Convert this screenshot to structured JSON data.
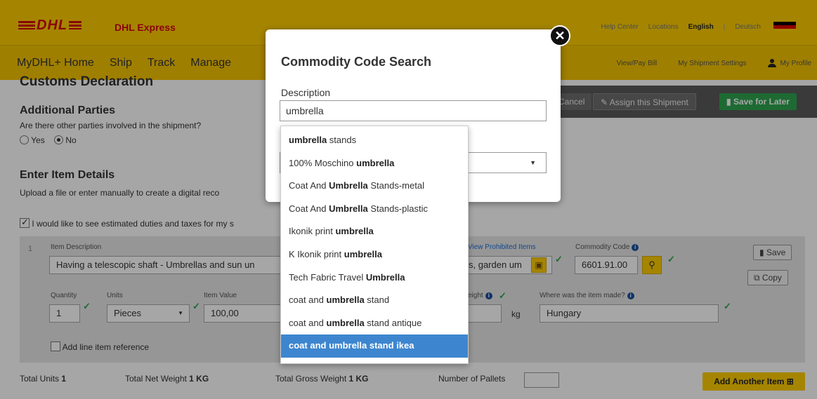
{
  "header": {
    "logo_text": "DHL",
    "brand": "DHL Express",
    "links": [
      "Help Center",
      "Locations"
    ],
    "lang_active": "English",
    "lang_other": "Deutsch"
  },
  "nav": {
    "left": [
      "MyDHL+ Home",
      "Ship",
      "Track",
      "Manage"
    ],
    "right": [
      "View/Pay Bill",
      "My Shipment Settings"
    ],
    "profile": "My Profile"
  },
  "page": {
    "section_title": "Customs Declaration",
    "actions": {
      "cancel": "Cancel",
      "assign": "Assign this Shipment",
      "save_later": "Save for Later"
    },
    "additional_parties": {
      "title": "Additional Parties",
      "question": "Are there other parties involved in the shipment?",
      "yes": "Yes",
      "no": "No"
    },
    "item_details": {
      "title": "Enter Item Details",
      "subtitle": "Upload a file or enter manually to create a digital reco",
      "estimate_checkbox": "I would like to see estimated duties and taxes for my s"
    },
    "item": {
      "number": "1",
      "description_label": "Item Description",
      "description_value": "Having a telescopic shaft - Umbrellas and sun un",
      "prohibited_link": "View Prohibited Items",
      "description_tail": "s, garden um",
      "commodity_label": "Commodity Code",
      "commodity_value": "6601.91.00",
      "save": "Save",
      "copy": "Copy",
      "quantity_label": "Quantity",
      "quantity_value": "1",
      "units_label": "Units",
      "units_value": "Pieces",
      "value_label": "Item Value",
      "value_value": "100,00",
      "weight_label": "eight",
      "weight_unit": "kg",
      "origin_label": "Where was the item made?",
      "origin_value": "Hungary",
      "line_ref": "Add line item reference"
    },
    "totals": {
      "units_label": "Total Units",
      "units_value": "1",
      "net_label": "Total Net Weight",
      "net_value": "1 KG",
      "gross_label": "Total Gross Weight",
      "gross_value": "1 KG",
      "pallets_label": "Number of Pallets",
      "add_item": "Add Another Item"
    }
  },
  "modal": {
    "title": "Commodity Code Search",
    "description_label": "Description",
    "description_value": "umbrella",
    "suggestions": [
      {
        "pre": "",
        "bold": "umbrella",
        "post": " stands"
      },
      {
        "pre": "100% Moschino ",
        "bold": "umbrella",
        "post": ""
      },
      {
        "pre": "Coat And ",
        "bold": "Umbrella",
        "post": " Stands-metal"
      },
      {
        "pre": "Coat And ",
        "bold": "Umbrella",
        "post": " Stands-plastic"
      },
      {
        "pre": "Ikonik print ",
        "bold": "umbrella",
        "post": ""
      },
      {
        "pre": "K Ikonik print ",
        "bold": "umbrella",
        "post": ""
      },
      {
        "pre": "Tech Fabric Travel ",
        "bold": "Umbrella",
        "post": ""
      },
      {
        "pre": "coat and ",
        "bold": "umbrella",
        "post": " stand"
      },
      {
        "pre": "coat and ",
        "bold": "umbrella",
        "post": " stand antique"
      },
      {
        "pre": "coat and ",
        "bold": "umbrella",
        "post": " stand ikea"
      }
    ],
    "active_index": 9
  },
  "colors": {
    "dhl_yellow": "#fecc00",
    "dhl_red": "#d40511",
    "success_green": "#2ea44f",
    "highlight_blue": "#3d86cf"
  }
}
